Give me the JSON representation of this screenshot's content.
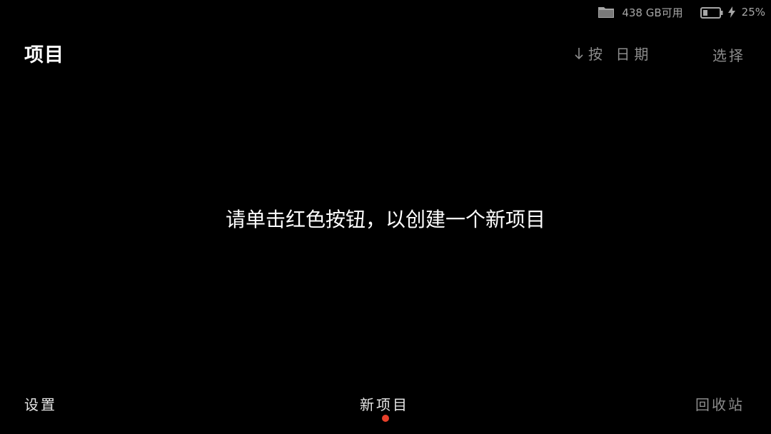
{
  "status_bar": {
    "storage": "438 GB可用",
    "battery": "25%"
  },
  "header": {
    "title": "项目",
    "sort_label": "按 日期",
    "select_label": "选择"
  },
  "empty_state": {
    "message": "请单击红色按钮，以创建一个新项目"
  },
  "bottom_nav": {
    "settings": "设置",
    "new_project": "新项目",
    "trash": "回收站"
  },
  "colors": {
    "background": "#000000",
    "accent": "#e8402a",
    "muted_text": "#8c8c8c"
  },
  "icons": [
    "folder-icon",
    "battery-icon",
    "charging-bolt-icon",
    "sort-arrow-down-icon"
  ]
}
